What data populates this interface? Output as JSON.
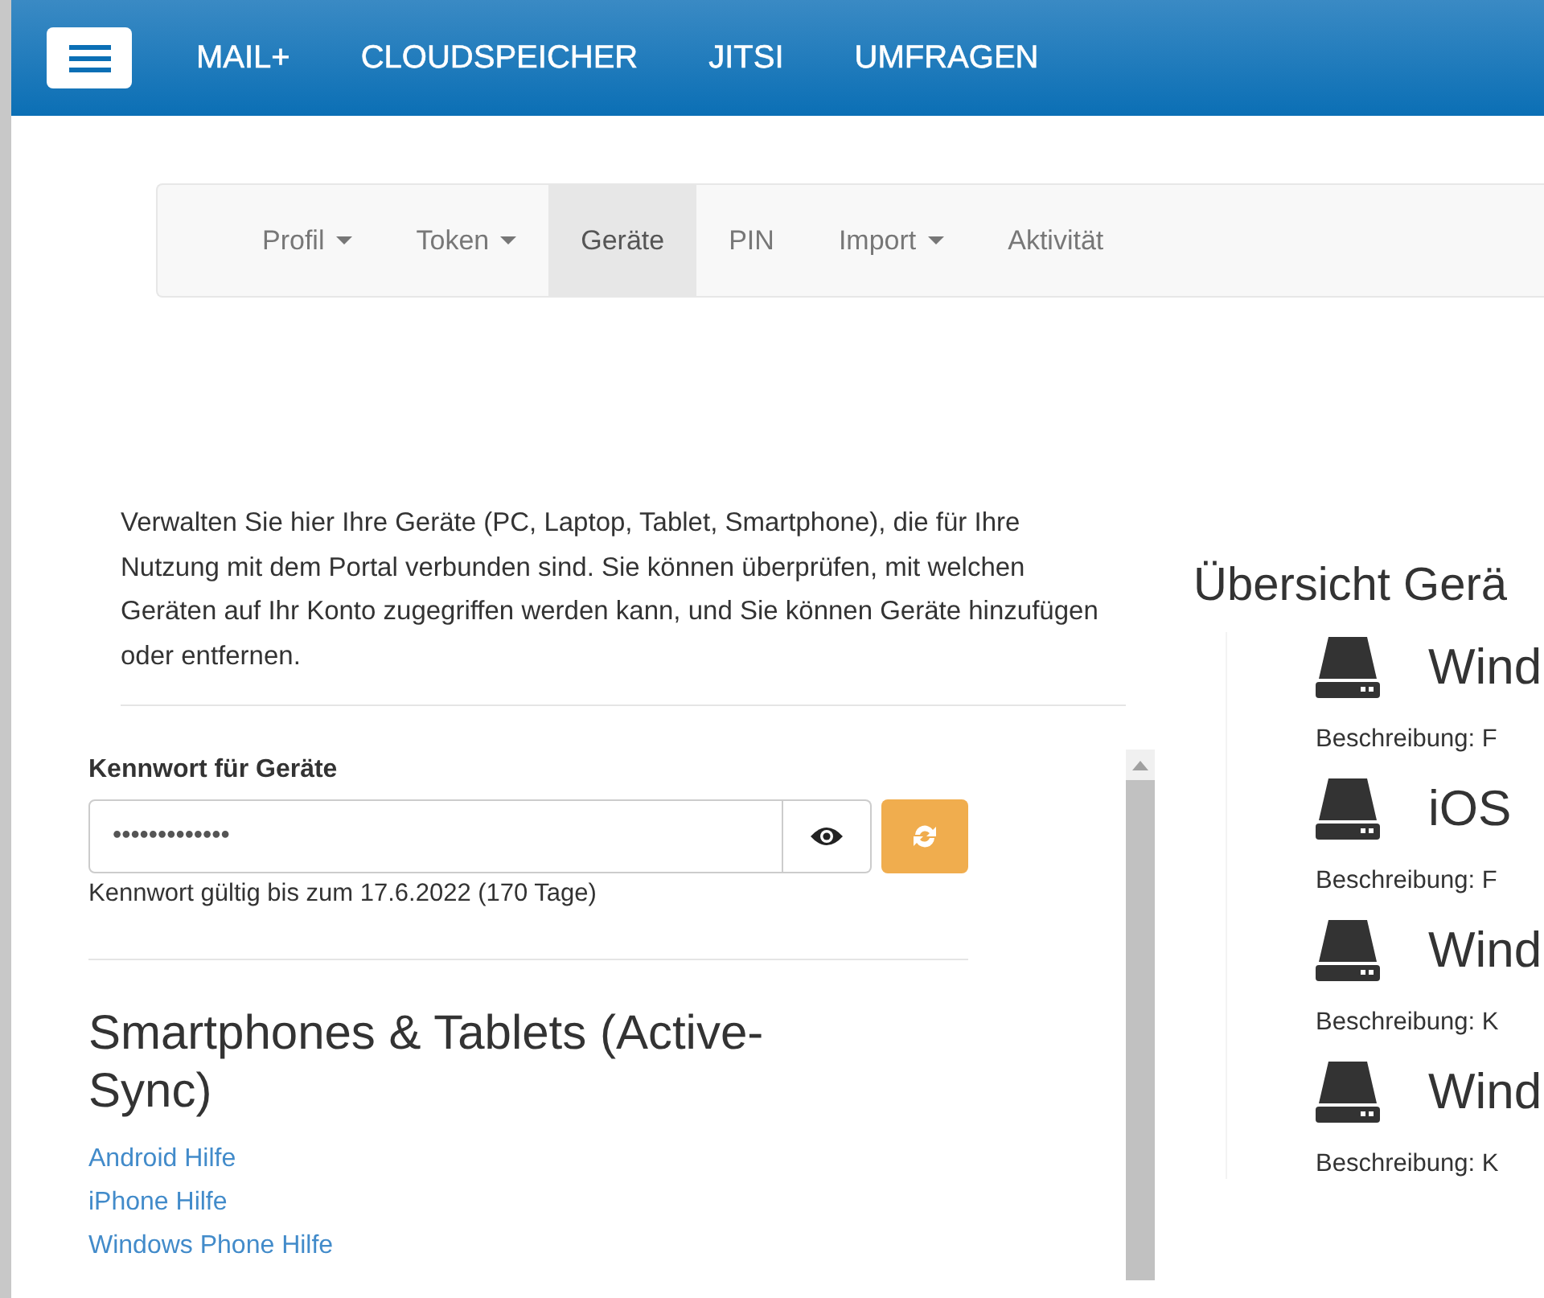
{
  "top_nav": {
    "items": [
      "MAIL+",
      "CLOUDSPEICHER",
      "JITSI",
      "UMFRAGEN"
    ]
  },
  "sub_nav": {
    "tabs": [
      {
        "label": "Profil",
        "dropdown": true,
        "selected": false
      },
      {
        "label": "Token",
        "dropdown": true,
        "selected": false
      },
      {
        "label": "Geräte",
        "dropdown": false,
        "selected": true
      },
      {
        "label": "PIN",
        "dropdown": false,
        "selected": false
      },
      {
        "label": "Import",
        "dropdown": true,
        "selected": false
      },
      {
        "label": "Aktivität",
        "dropdown": false,
        "selected": false
      }
    ]
  },
  "intro": "Verwalten Sie hier Ihre Geräte (PC, Laptop, Tablet, Smartphone), die für Ihre Nutzung mit dem Portal verbunden sind. Sie können überprüfen, mit welchen Geräten auf Ihr Konto zugegriffen werden kann, und Sie können Geräte hinzufügen oder entfernen.",
  "password": {
    "label": "Kennwort für Geräte",
    "value": "•••••••••••••",
    "validity": "Kennwort gültig bis zum 17.6.2022 (170 Tage)"
  },
  "activesync": {
    "heading": "Smartphones & Tablets (Active-Sync)",
    "links": [
      "Android Hilfe",
      "iPhone Hilfe",
      "Windows Phone Hilfe"
    ]
  },
  "overview": {
    "heading": "Übersicht Gerä",
    "devices": [
      {
        "name": "Wind",
        "description": "Beschreibung: F"
      },
      {
        "name": "iOS",
        "description": "Beschreibung: F"
      },
      {
        "name": "Wind",
        "description": "Beschreibung: K"
      },
      {
        "name": "Wind",
        "description": "Beschreibung: K"
      }
    ]
  }
}
